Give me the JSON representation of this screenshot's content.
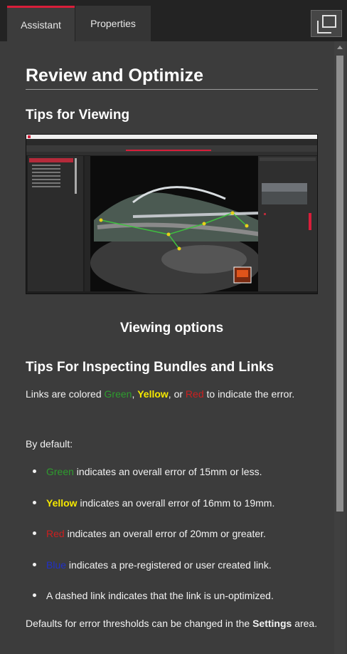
{
  "tabs": {
    "assistant": "Assistant",
    "properties": "Properties"
  },
  "content": {
    "title": "Review and Optimize",
    "tips_viewing": "Tips for Viewing",
    "image_caption": "Viewing options",
    "tips_inspecting": "Tips For Inspecting Bundles and Links",
    "links_colored": {
      "pre": "Links are colored ",
      "green": "Green",
      "sep1": ", ",
      "yellow": "Yellow",
      "sep2": ", or ",
      "red": "Red",
      "post": " to indicate the error."
    },
    "by_default": "By default:",
    "bullets": [
      {
        "color_word": "Green",
        "text": " indicates an overall error of 15mm or less."
      },
      {
        "color_word": "Yellow",
        "text": " indicates an overall error of 16mm to 19mm."
      },
      {
        "color_word": "Red",
        "text": " indicates an overall error of 20mm or greater."
      },
      {
        "color_word": "Blue",
        "text": " indicates a pre-registered or user created link."
      },
      {
        "color_word": "",
        "text": "A dashed link indicates that the link is un-optimized."
      }
    ],
    "defaults_note": {
      "pre": "Defaults for error thresholds can be changed in the ",
      "bold": "Settings",
      "post": " area."
    }
  },
  "colors": {
    "accent": "#d81e3a",
    "green": "#2e9c2e",
    "yellow": "#f5e800",
    "red": "#cc1f1f",
    "blue": "#2030c8"
  }
}
